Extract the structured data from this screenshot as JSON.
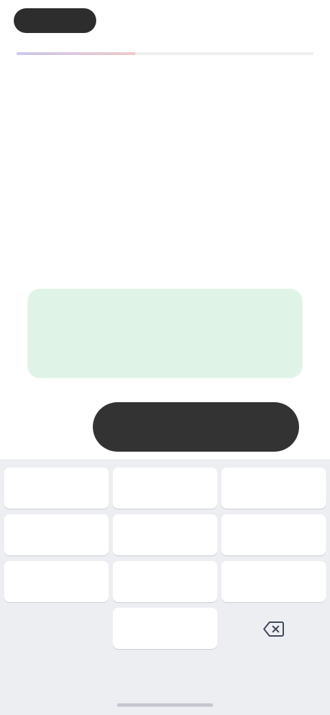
{
  "header": {
    "back_label": "",
    "step_label": "",
    "progress_fraction": 0.4
  },
  "main": {
    "title": "",
    "amount": "",
    "subvalue_left": "",
    "subvalue_right": ""
  },
  "info_card": {
    "title": "",
    "text": ""
  },
  "actions": {
    "side_label": "",
    "continue_label": ""
  },
  "keypad": {
    "keys": [
      "",
      "",
      "",
      "",
      "",
      "",
      "",
      "",
      "",
      "",
      "",
      ""
    ]
  },
  "colors": {
    "primary_button": "#333333",
    "info_card_bg": "#dff4e6",
    "keypad_bg": "#eceef2"
  },
  "icons": {
    "delete": "backspace-icon"
  }
}
